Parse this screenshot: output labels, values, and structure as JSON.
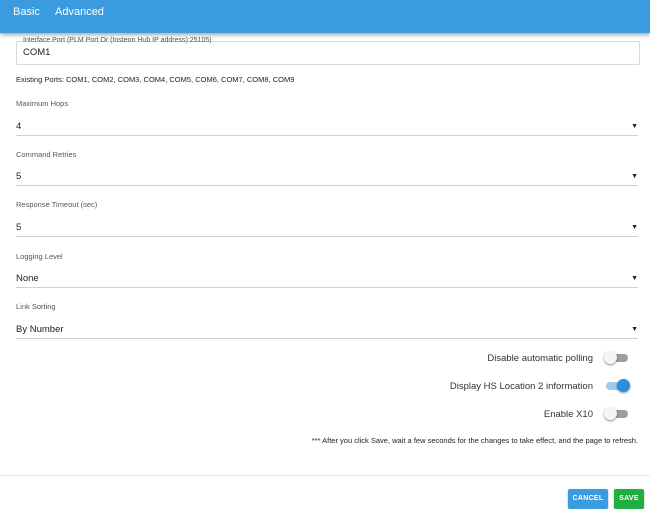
{
  "tabs": {
    "basic": "Basic",
    "advanced": "Advanced"
  },
  "interface_port": {
    "label": "Interface Port (PLM Port Or (Insteon Hub IP address):25105)",
    "value": "COM1"
  },
  "existing_ports": "Existing Ports: COM1, COM2, COM3, COM4, COM5, COM6, COM7, COM8, COM9",
  "fields": {
    "maximum_hops": {
      "label": "Maximum Hops",
      "value": "4"
    },
    "command_retries": {
      "label": "Command Retries",
      "value": "5"
    },
    "response_timeout": {
      "label": "Response Timeout (sec)",
      "value": "5"
    },
    "logging_level": {
      "label": "Logging Level",
      "value": "None"
    },
    "link_sorting": {
      "label": "Link Sorting",
      "value": "By Number"
    }
  },
  "caret": "▼",
  "toggles": {
    "disable_polling": {
      "label": "Disable automatic polling",
      "on": false
    },
    "display_hs_location": {
      "label": "Display HS Location 2 information",
      "on": true
    },
    "enable_x10": {
      "label": "Enable X10",
      "on": false
    }
  },
  "note": "*** After you click Save, wait a few seconds for the changes to take effect, and the page to refresh.",
  "buttons": {
    "cancel": "CANCEL",
    "save": "SAVE"
  },
  "colors": {
    "header": "#3a9be0",
    "cancel": "#3a9be0",
    "save": "#1fae3f",
    "toggle_on": "#2a8fdc"
  }
}
